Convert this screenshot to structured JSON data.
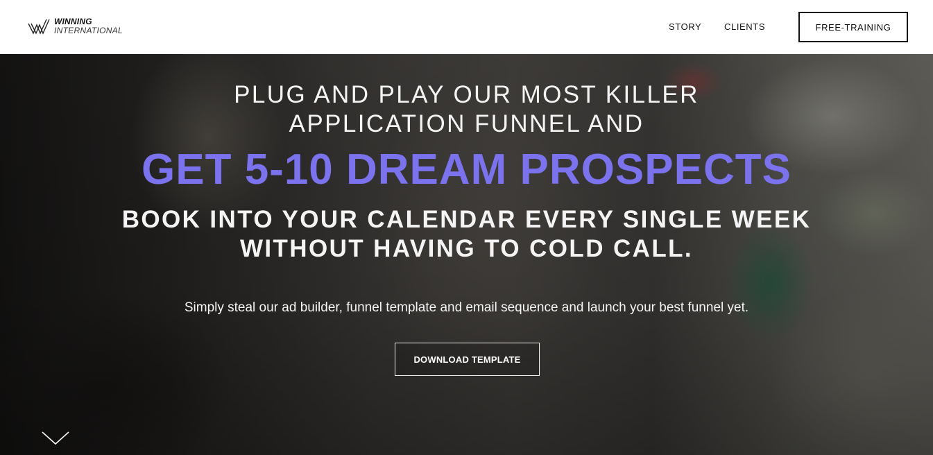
{
  "header": {
    "logo": {
      "line1": "WINNING",
      "line2": "INTERNATIONAL"
    },
    "nav": [
      {
        "label": "STORY"
      },
      {
        "label": "CLIENTS"
      }
    ],
    "cta_label": "FREE-TRAINING"
  },
  "hero": {
    "headline_line1": "PLUG AND PLAY OUR MOST KILLER",
    "headline_line2": "APPLICATION FUNNEL AND",
    "highlight": "GET 5-10 DREAM PROSPECTS",
    "headline_line3": "BOOK INTO YOUR CALENDAR EVERY SINGLE WEEK",
    "headline_line4": "WITHOUT HAVING TO COLD CALL.",
    "subtext": "Simply steal our ad builder, funnel template and email sequence and launch your best funnel yet.",
    "cta_label": "DOWNLOAD TEMPLATE",
    "scroll_icon": "chevron-down-icon"
  },
  "colors": {
    "accent": "#7b72ee",
    "header_bg": "#ffffff",
    "text_light": "#f4f4f4"
  }
}
